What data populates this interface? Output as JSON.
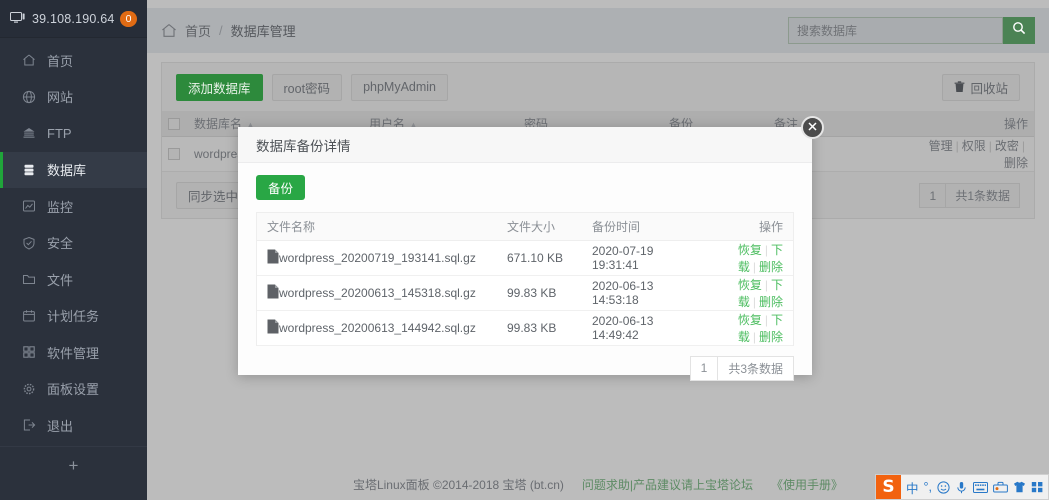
{
  "sidebar": {
    "ip": "39.108.190.64",
    "badge": "0",
    "add_label": "+",
    "items": [
      {
        "label": "首页",
        "icon": "home-icon",
        "active": false
      },
      {
        "label": "网站",
        "icon": "globe-icon",
        "active": false
      },
      {
        "label": "FTP",
        "icon": "ftp-icon",
        "active": false
      },
      {
        "label": "数据库",
        "icon": "database-icon",
        "active": true
      },
      {
        "label": "监控",
        "icon": "monitor-chart-icon",
        "active": false
      },
      {
        "label": "安全",
        "icon": "shield-icon",
        "active": false
      },
      {
        "label": "文件",
        "icon": "folder-icon",
        "active": false
      },
      {
        "label": "计划任务",
        "icon": "calendar-icon",
        "active": false
      },
      {
        "label": "软件管理",
        "icon": "grid-icon",
        "active": false
      },
      {
        "label": "面板设置",
        "icon": "gear-icon",
        "active": false
      },
      {
        "label": "退出",
        "icon": "logout-icon",
        "active": false
      }
    ]
  },
  "topbar": {
    "home_label": "首页",
    "separator": "/",
    "current": "数据库管理",
    "search_placeholder": "搜索数据库",
    "search_value": ""
  },
  "toolbar": {
    "add_db": "添加数据库",
    "root_password": "root密码",
    "phpmyadmin": "phpMyAdmin",
    "recycle_bin": "回收站",
    "sync_selected": "同步选中"
  },
  "bg_table": {
    "columns": [
      "数据库名",
      "用户名",
      "密码",
      "备份",
      "备注",
      "操作"
    ],
    "rows": [
      {
        "name": "wordpress",
        "user": "",
        "password": "",
        "backup": "",
        "remark": "",
        "actions": [
          "管理",
          "权限",
          "改密",
          "删除"
        ]
      }
    ],
    "pager": {
      "page": "1",
      "total": "共1条数据"
    }
  },
  "modal": {
    "title": "数据库备份详情",
    "backup_button": "备份",
    "close_icon": "close-icon",
    "columns": [
      "文件名称",
      "文件大小",
      "备份时间",
      "操作"
    ],
    "rows": [
      {
        "filename": "wordpress_20200719_193141.sql.gz",
        "size": "671.10 KB",
        "time": "2020-07-19 19:31:41",
        "actions": [
          "恢复",
          "下载",
          "删除"
        ]
      },
      {
        "filename": "wordpress_20200613_145318.sql.gz",
        "size": "99.83 KB",
        "time": "2020-06-13 14:53:18",
        "actions": [
          "恢复",
          "下载",
          "删除"
        ]
      },
      {
        "filename": "wordpress_20200613_144942.sql.gz",
        "size": "99.83 KB",
        "time": "2020-06-13 14:49:42",
        "actions": [
          "恢复",
          "下载",
          "删除"
        ]
      }
    ],
    "pager": {
      "page": "1",
      "total": "共3条数据"
    }
  },
  "footer": {
    "copyright": "宝塔Linux面板 ©2014-2018 宝塔 (bt.cn)",
    "link_forum": "问题求助|产品建议请上宝塔论坛",
    "link_manual": "《使用手册》"
  },
  "ime": {
    "logo": "S",
    "items": [
      "中",
      "°,",
      "☺",
      "🎤",
      "⌨",
      "🔊",
      "👕",
      "▦"
    ]
  },
  "colors": {
    "accent_green": "#29a745",
    "sidebar_bg": "#2b313c",
    "badge_orange": "#e06b14",
    "link_green": "#4bbd5f"
  }
}
